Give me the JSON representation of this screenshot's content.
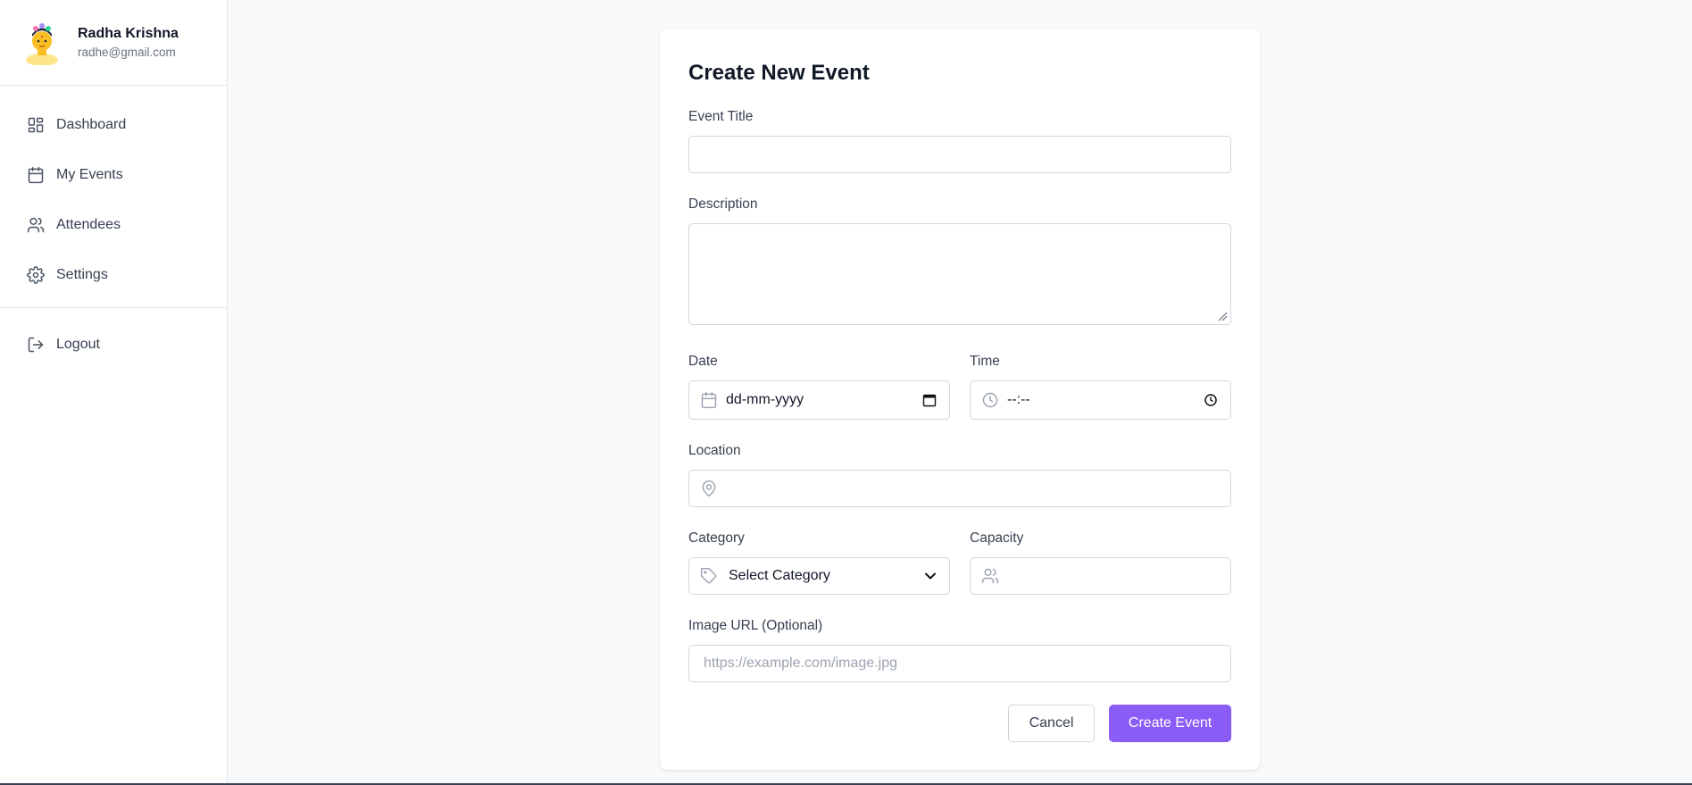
{
  "user": {
    "name": "Radha Krishna",
    "email": "radhe@gmail.com"
  },
  "sidebar": {
    "items": [
      {
        "label": "Dashboard",
        "icon": "layout-dashboard-icon"
      },
      {
        "label": "My Events",
        "icon": "calendar-icon"
      },
      {
        "label": "Attendees",
        "icon": "users-icon"
      },
      {
        "label": "Settings",
        "icon": "gear-icon"
      }
    ],
    "logout_label": "Logout"
  },
  "form": {
    "title": "Create New Event",
    "event_title": {
      "label": "Event Title",
      "value": ""
    },
    "description": {
      "label": "Description",
      "value": ""
    },
    "date": {
      "label": "Date",
      "value": "dd-mm-yyyy"
    },
    "time": {
      "label": "Time",
      "value": "--:--"
    },
    "location": {
      "label": "Location",
      "value": ""
    },
    "category": {
      "label": "Category",
      "value": "Select Category"
    },
    "capacity": {
      "label": "Capacity",
      "value": ""
    },
    "image_url": {
      "label": "Image URL (Optional)",
      "placeholder": "https://example.com/image.jpg"
    },
    "cancel_label": "Cancel",
    "submit_label": "Create Event"
  },
  "colors": {
    "accent": "#8b5cf6",
    "background": "#f8f9fb",
    "border": "#d1d5db"
  }
}
